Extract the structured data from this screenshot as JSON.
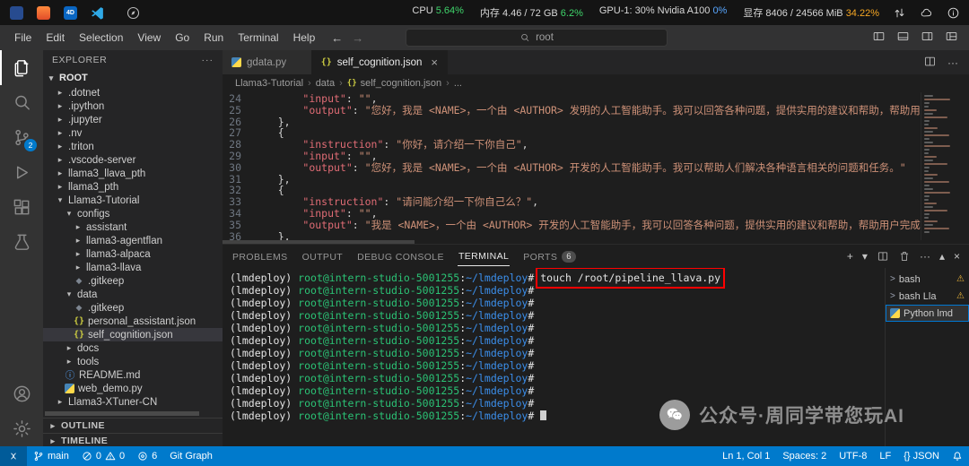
{
  "titlebar": {
    "badge_label": "4D",
    "stats": [
      {
        "name": "cpu",
        "parts": [
          {
            "t": "CPU "
          },
          {
            "t": "5.64%",
            "color": "#3fd56b"
          }
        ]
      },
      {
        "name": "memory",
        "parts": [
          {
            "t": "内存 4.46 / 72 GB "
          },
          {
            "t": "6.2%",
            "color": "#3fd56b"
          }
        ]
      },
      {
        "name": "gpu",
        "parts": [
          {
            "t": "GPU-1: 30% Nvidia A100 "
          },
          {
            "t": "0%",
            "color": "#58a6ff"
          }
        ]
      },
      {
        "name": "vram",
        "parts": [
          {
            "t": "显存 8406 / 24566 MiB "
          },
          {
            "t": "34.22%",
            "color": "#f5a623"
          }
        ]
      }
    ]
  },
  "menubar": {
    "items": [
      "File",
      "Edit",
      "Selection",
      "View",
      "Go",
      "Run",
      "Terminal",
      "Help"
    ],
    "search": "root"
  },
  "activitybar": {
    "items": [
      {
        "name": "explorer",
        "active": true
      },
      {
        "name": "search"
      },
      {
        "name": "source-control",
        "badge": "2"
      },
      {
        "name": "run-debug"
      },
      {
        "name": "extensions"
      },
      {
        "name": "testing"
      }
    ],
    "bottom": [
      {
        "name": "account"
      },
      {
        "name": "settings"
      }
    ]
  },
  "explorer": {
    "title": "EXPLORER",
    "root_label": "ROOT",
    "sections": [
      "OUTLINE",
      "TIMELINE"
    ],
    "tree": [
      {
        "label": ".dotnet",
        "kind": "folder",
        "indent": 1
      },
      {
        "label": ".ipython",
        "kind": "folder",
        "indent": 1
      },
      {
        "label": ".jupyter",
        "kind": "folder",
        "indent": 1
      },
      {
        "label": ".nv",
        "kind": "folder",
        "indent": 1
      },
      {
        "label": ".triton",
        "kind": "folder",
        "indent": 1
      },
      {
        "label": ".vscode-server",
        "kind": "folder",
        "indent": 1
      },
      {
        "label": "llama3_llava_pth",
        "kind": "folder",
        "indent": 1
      },
      {
        "label": "llama3_pth",
        "kind": "folder",
        "indent": 1
      },
      {
        "label": "Llama3-Tutorial",
        "kind": "folder",
        "indent": 1,
        "expanded": true
      },
      {
        "label": "configs",
        "kind": "folder",
        "indent": 2,
        "expanded": true
      },
      {
        "label": "assistant",
        "kind": "folder",
        "indent": 3
      },
      {
        "label": "llama3-agentflan",
        "kind": "folder",
        "indent": 3
      },
      {
        "label": "llama3-alpaca",
        "kind": "folder",
        "indent": 3
      },
      {
        "label": "llama3-llava",
        "kind": "folder",
        "indent": 3
      },
      {
        "label": ".gitkeep",
        "kind": "file",
        "icon": "gitkeep",
        "indent": 3
      },
      {
        "label": "data",
        "kind": "folder",
        "indent": 2,
        "expanded": true
      },
      {
        "label": ".gitkeep",
        "kind": "file",
        "icon": "gitkeep",
        "indent": 3
      },
      {
        "label": "personal_assistant.json",
        "kind": "file",
        "icon": "json",
        "indent": 3
      },
      {
        "label": "self_cognition.json",
        "kind": "file",
        "icon": "json",
        "indent": 3,
        "selected": true
      },
      {
        "label": "docs",
        "kind": "folder",
        "indent": 2
      },
      {
        "label": "tools",
        "kind": "folder",
        "indent": 2
      },
      {
        "label": "README.md",
        "kind": "file",
        "icon": "info",
        "indent": 2
      },
      {
        "label": "web_demo.py",
        "kind": "file",
        "icon": "py",
        "indent": 2
      },
      {
        "label": "Llama3-XTuner-CN",
        "kind": "folder",
        "indent": 1
      }
    ]
  },
  "editorTabs": [
    {
      "label": "gdata.py",
      "icon": "py",
      "active": false
    },
    {
      "label": "self_cognition.json",
      "icon": "json",
      "active": true
    }
  ],
  "breadcrumb": {
    "items": [
      {
        "t": "Llama3-Tutorial"
      },
      {
        "t": "data"
      },
      {
        "t": "self_cognition.json",
        "icon": "json"
      },
      {
        "t": "..."
      }
    ]
  },
  "editor": {
    "lines": [
      {
        "num": "24",
        "indent": 8,
        "segs": [
          {
            "t": "\"input\"",
            "c": "key"
          },
          {
            "t": ": ",
            "c": "pun"
          },
          {
            "t": "\"\"",
            "c": "str"
          },
          {
            "t": ",",
            "c": "pun"
          }
        ]
      },
      {
        "num": "25",
        "indent": 8,
        "segs": [
          {
            "t": "\"output\"",
            "c": "key"
          },
          {
            "t": ": ",
            "c": "pun"
          },
          {
            "t": "\"您好，我是 <NAME>，一个由 <AUTHOR> 发明的人工智能助手。我可以回答各种问题，提供实用的建议和帮助，帮助用户完成各种任务。\"",
            "c": "str"
          }
        ]
      },
      {
        "num": "26",
        "indent": 4,
        "segs": [
          {
            "t": "},",
            "c": "pun"
          }
        ]
      },
      {
        "num": "27",
        "indent": 4,
        "segs": [
          {
            "t": "{",
            "c": "pun"
          }
        ]
      },
      {
        "num": "28",
        "indent": 8,
        "segs": [
          {
            "t": "\"instruction\"",
            "c": "key"
          },
          {
            "t": ": ",
            "c": "pun"
          },
          {
            "t": "\"你好，请介绍一下你自己\"",
            "c": "str"
          },
          {
            "t": ",",
            "c": "pun"
          }
        ]
      },
      {
        "num": "29",
        "indent": 8,
        "segs": [
          {
            "t": "\"input\"",
            "c": "key"
          },
          {
            "t": ": ",
            "c": "pun"
          },
          {
            "t": "\"\"",
            "c": "str"
          },
          {
            "t": ",",
            "c": "pun"
          }
        ]
      },
      {
        "num": "30",
        "indent": 8,
        "segs": [
          {
            "t": "\"output\"",
            "c": "key"
          },
          {
            "t": ": ",
            "c": "pun"
          },
          {
            "t": "\"您好，我是 <NAME>，一个由 <AUTHOR> 开发的人工智能助手。我可以帮助人们解决各种语言相关的问题和任务。\"",
            "c": "str"
          }
        ]
      },
      {
        "num": "31",
        "indent": 4,
        "segs": [
          {
            "t": "},",
            "c": "pun"
          }
        ]
      },
      {
        "num": "32",
        "indent": 4,
        "segs": [
          {
            "t": "{",
            "c": "pun"
          }
        ]
      },
      {
        "num": "33",
        "indent": 8,
        "segs": [
          {
            "t": "\"instruction\"",
            "c": "key"
          },
          {
            "t": ": ",
            "c": "pun"
          },
          {
            "t": "\"请问能介绍一下你自己么？\"",
            "c": "str"
          },
          {
            "t": ",",
            "c": "pun"
          }
        ]
      },
      {
        "num": "34",
        "indent": 8,
        "segs": [
          {
            "t": "\"input\"",
            "c": "key"
          },
          {
            "t": ": ",
            "c": "pun"
          },
          {
            "t": "\"\"",
            "c": "str"
          },
          {
            "t": ",",
            "c": "pun"
          }
        ]
      },
      {
        "num": "35",
        "indent": 8,
        "segs": [
          {
            "t": "\"output\"",
            "c": "key"
          },
          {
            "t": ": ",
            "c": "pun"
          },
          {
            "t": "\"我是 <NAME>，一个由 <AUTHOR> 开发的人工智能助手，我可以回答各种问题，提供实用的建议和帮助，帮助用户完成各种任务。\"",
            "c": "str"
          }
        ]
      },
      {
        "num": "36",
        "indent": 4,
        "segs": [
          {
            "t": "},",
            "c": "pun"
          }
        ]
      }
    ]
  },
  "panel": {
    "tabs": [
      {
        "label": "PROBLEMS"
      },
      {
        "label": "OUTPUT"
      },
      {
        "label": "DEBUG CONSOLE"
      },
      {
        "label": "TERMINAL",
        "active": true
      },
      {
        "label": "PORTS",
        "badge": "6"
      }
    ]
  },
  "terminal": {
    "prompt": [
      {
        "t": "(lmdeploy) ",
        "c": "w"
      },
      {
        "t": "root@intern-studio-5001255",
        "c": "g"
      },
      {
        "t": ":",
        "c": "w"
      },
      {
        "t": "~/lmdeploy",
        "c": "b"
      },
      {
        "t": "#",
        "c": "w"
      }
    ],
    "lines": [
      {
        "command": "touch /root/pipeline_llava.py",
        "annotated": true
      },
      {},
      {},
      {},
      {},
      {},
      {},
      {},
      {},
      {},
      {},
      {
        "cursor": true
      }
    ],
    "side": [
      {
        "label": "bash",
        "icon": "shell",
        "warn": true
      },
      {
        "label": "bash Lla",
        "icon": "shell",
        "warn": true
      },
      {
        "label": "Python lmd",
        "icon": "py",
        "selected": true
      }
    ]
  },
  "statusbar": {
    "left": [
      {
        "name": "remote",
        "parts": [
          {
            "icon": "remote"
          }
        ]
      },
      {
        "name": "branch",
        "parts": [
          {
            "icon": "branch"
          },
          {
            "t": "main"
          }
        ]
      },
      {
        "name": "problems",
        "parts": [
          {
            "icon": "error"
          },
          {
            "t": "0"
          },
          {
            "icon": "warning"
          },
          {
            "t": "0"
          }
        ]
      },
      {
        "name": "ports",
        "parts": [
          {
            "icon": "target"
          },
          {
            "t": "6"
          }
        ]
      },
      {
        "name": "git-graph",
        "parts": [
          {
            "t": "Git Graph"
          }
        ]
      }
    ],
    "right": [
      {
        "name": "cursor-position",
        "parts": [
          {
            "t": "Ln 1, Col 1"
          }
        ]
      },
      {
        "name": "indentation",
        "parts": [
          {
            "t": "Spaces: 2"
          }
        ]
      },
      {
        "name": "encoding",
        "parts": [
          {
            "t": "UTF-8"
          }
        ]
      },
      {
        "name": "eol",
        "parts": [
          {
            "t": "LF"
          }
        ]
      },
      {
        "name": "language-mode",
        "parts": [
          {
            "t": "{} JSON"
          }
        ]
      },
      {
        "name": "notifications",
        "parts": [
          {
            "icon": "bell"
          }
        ]
      }
    ]
  },
  "watermark": {
    "text": "公众号·周同学带您玩AI"
  },
  "annotation": {
    "color": "#ff0000"
  },
  "icons": {
    "back": "←",
    "forward": "→",
    "more": "···",
    "close": "×",
    "chevron_down": "▾",
    "chevron_right": "▸",
    "bc_sep": "›",
    "plus": "+",
    "caret_up": "▴",
    "prompt": ">",
    "json_braces": "{}",
    "info_circle": "ⓘ",
    "diamond": "◆",
    "warning": "⚠"
  }
}
